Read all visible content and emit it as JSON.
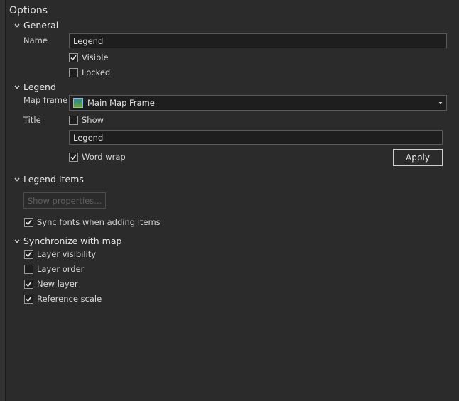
{
  "pane": {
    "title": "Options"
  },
  "general": {
    "header": "General",
    "name_label": "Name",
    "name_value": "Legend",
    "visible_label": "Visible",
    "visible_checked": true,
    "locked_label": "Locked",
    "locked_checked": false
  },
  "legend": {
    "header": "Legend",
    "map_frame_label": "Map frame",
    "map_frame_value": "Main Map Frame",
    "map_frame_icon": "map-frame-icon",
    "title_label": "Title",
    "show_label": "Show",
    "show_checked": false,
    "title_value": "Legend",
    "word_wrap_label": "Word wrap",
    "word_wrap_checked": true,
    "apply_label": "Apply"
  },
  "legend_items": {
    "header": "Legend Items",
    "show_properties_label": "Show properties...",
    "sync_fonts_label": "Sync fonts when adding items",
    "sync_fonts_checked": true
  },
  "synchronize": {
    "header": "Synchronize with map",
    "items": [
      {
        "label": "Layer visibility",
        "checked": true
      },
      {
        "label": "Layer order",
        "checked": false
      },
      {
        "label": "New layer",
        "checked": true
      },
      {
        "label": "Reference scale",
        "checked": true
      }
    ]
  },
  "colors": {
    "background": "#2b2b2b",
    "input_background": "#1e1e1e",
    "border": "#5a5a5a",
    "text": "#d6d6d6"
  }
}
